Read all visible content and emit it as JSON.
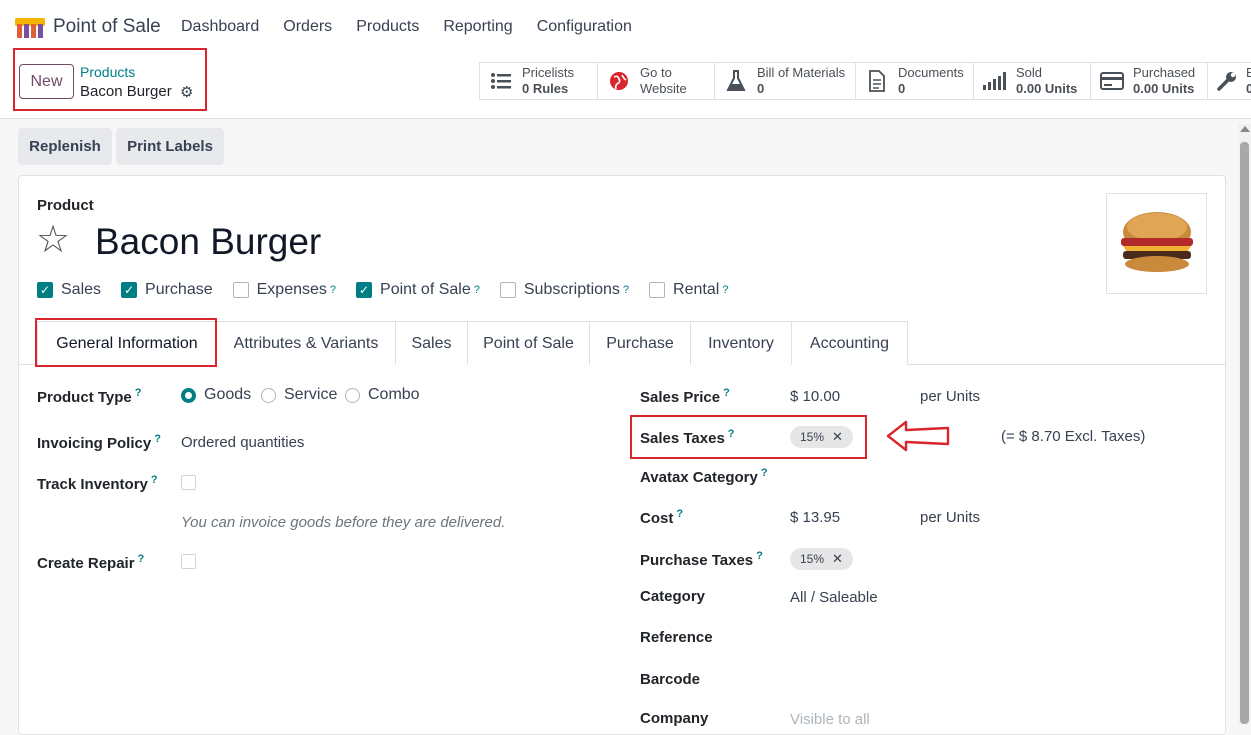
{
  "navbar": {
    "app_name": "Point of Sale",
    "menu": [
      "Dashboard",
      "Orders",
      "Products",
      "Reporting",
      "Configuration"
    ]
  },
  "control": {
    "new_label": "New",
    "breadcrumb_parent": "Products",
    "breadcrumb_current": "Bacon Burger",
    "stats": [
      {
        "icon": "list-icon",
        "line1": "Pricelists",
        "line2": "0 Rules"
      },
      {
        "icon": "globe-icon",
        "line1": "Go to",
        "line2": "Website"
      },
      {
        "icon": "flask-icon",
        "line1": "Bill of Materials",
        "line2": "0"
      },
      {
        "icon": "document-icon",
        "line1": "Documents",
        "line2": "0"
      },
      {
        "icon": "bar-chart-icon",
        "line1": "Sold",
        "line2": "0.00 Units"
      },
      {
        "icon": "credit-card-icon",
        "line1": "Purchased",
        "line2": "0.00 Units"
      },
      {
        "icon": "wrench-icon",
        "line1": "E",
        "line2": "0"
      }
    ]
  },
  "actions": {
    "replenish": "Replenish",
    "print_labels": "Print Labels"
  },
  "form": {
    "product_label": "Product",
    "product_name": "Bacon Burger",
    "checkboxes": [
      {
        "label": "Sales",
        "checked": true,
        "help": false
      },
      {
        "label": "Purchase",
        "checked": true,
        "help": false
      },
      {
        "label": "Expenses",
        "checked": false,
        "help": true
      },
      {
        "label": "Point of Sale",
        "checked": true,
        "help": true
      },
      {
        "label": "Subscriptions",
        "checked": false,
        "help": true
      },
      {
        "label": "Rental",
        "checked": false,
        "help": true
      }
    ],
    "help_mark": "?",
    "tabs": [
      "General Information",
      "Attributes & Variants",
      "Sales",
      "Point of Sale",
      "Purchase",
      "Inventory",
      "Accounting"
    ],
    "left": {
      "product_type_label": "Product Type",
      "product_type_options": [
        "Goods",
        "Service",
        "Combo"
      ],
      "product_type_selected": "Goods",
      "invoicing_policy_label": "Invoicing Policy",
      "invoicing_policy_value": "Ordered quantities",
      "track_inventory_label": "Track Inventory",
      "help_text": "You can invoice goods before they are delivered.",
      "create_repair_label": "Create Repair"
    },
    "right": {
      "sales_price_label": "Sales Price",
      "sales_price_value": "$ 10.00",
      "sales_price_unit": "per Units",
      "sales_taxes_label": "Sales Taxes",
      "sales_taxes_tag": "15%",
      "sales_taxes_note": "(= $ 8.70 Excl. Taxes)",
      "avatax_label": "Avatax Category",
      "cost_label": "Cost",
      "cost_value": "$ 13.95",
      "cost_unit": "per Units",
      "purchase_taxes_label": "Purchase Taxes",
      "purchase_taxes_tag": "15%",
      "category_label": "Category",
      "category_value": "All / Saleable",
      "reference_label": "Reference",
      "barcode_label": "Barcode",
      "company_label": "Company",
      "company_value": "Visible to all"
    },
    "tag_remove": "✕"
  },
  "colors": {
    "accent": "#017e84",
    "brand": "#714b67",
    "highlight": "#d8262c"
  }
}
